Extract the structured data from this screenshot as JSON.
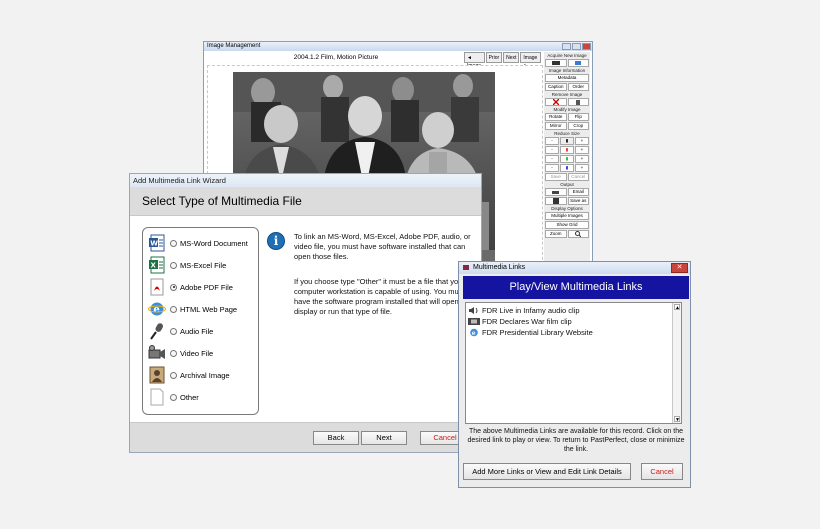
{
  "image_window": {
    "title": "Image Management",
    "caption": "2004.1.2 Film, Motion Picture",
    "nav": [
      "◄ Image",
      "Prior",
      "Next",
      "Image ►"
    ],
    "side_panel": {
      "acquire_label": "Acquire New Image",
      "info_label": "Image Information",
      "metadata": "Metadata",
      "caption_btn": "Caption",
      "order_btn": "Order",
      "remove_label": "Remove Image",
      "modify_label": "Modify Image",
      "rotate": "Rotate",
      "flip": "Flip",
      "mirror": "Mirror",
      "crop": "Crop",
      "reduce_label": "Reduce Size",
      "save": "Save",
      "cancel": "Cancel",
      "output_label": "Output",
      "email": "Email",
      "save_as": "Save as",
      "display_label": "Display Options",
      "multiple": "Multiple Images",
      "grid": "Show Grid",
      "zoom": "Zoom"
    }
  },
  "wizard": {
    "title": "Add Multimedia Link Wizard",
    "heading": "Select Type of Multimedia File",
    "types": [
      {
        "label": "MS-Word Document",
        "icon": "word-doc-icon",
        "selected": false
      },
      {
        "label": "MS-Excel File",
        "icon": "excel-icon",
        "selected": false
      },
      {
        "label": "Adobe PDF File",
        "icon": "pdf-icon",
        "selected": true
      },
      {
        "label": "HTML Web Page",
        "icon": "ie-globe-icon",
        "selected": false
      },
      {
        "label": "Audio File",
        "icon": "microphone-icon",
        "selected": false
      },
      {
        "label": "Video File",
        "icon": "video-camera-icon",
        "selected": false
      },
      {
        "label": "Archival Image",
        "icon": "portrait-icon",
        "selected": false
      },
      {
        "label": "Other",
        "icon": "blank-doc-icon",
        "selected": false
      }
    ],
    "info_text_1": "To link an MS-Word, MS-Excel, Adobe PDF, audio, or video file, you must have software installed that can open those files.",
    "info_text_2": "If you choose type \"Other\" it must be a file that your computer workstation is capable of using.  You must have the software program installed that will open, display or run that type of file.",
    "back": "Back",
    "next": "Next",
    "cancel": "Cancel"
  },
  "links_window": {
    "title": "Multimedia Links",
    "heading": "Play/View Multimedia Links",
    "items": [
      {
        "label": "FDR Live in Infamy audio clip",
        "icon": "speaker-icon"
      },
      {
        "label": "FDR Declares War film clip",
        "icon": "film-icon"
      },
      {
        "label": "FDR Presidential Library Website",
        "icon": "ie-globe-icon"
      }
    ],
    "footer_text": "The above Multimedia Links are available for this record. Click on the desired link to play or view.  To return to PastPerfect, close or minimize the link.",
    "add_more": "Add More Links or View and Edit Link Details",
    "cancel": "Cancel"
  }
}
